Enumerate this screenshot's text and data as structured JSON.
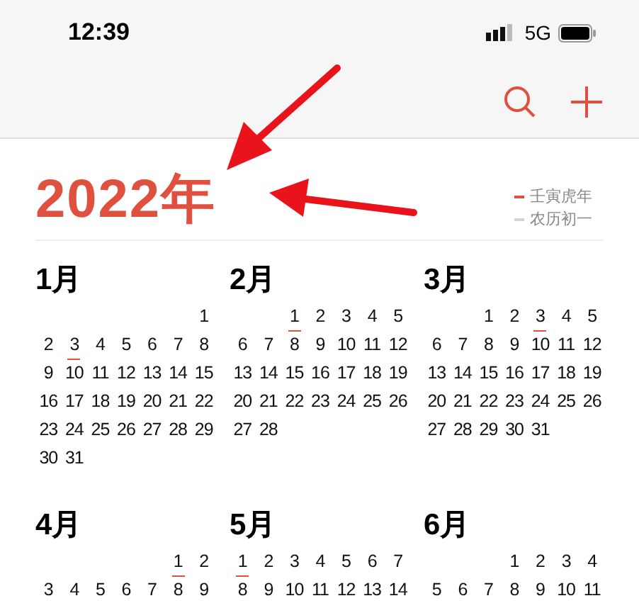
{
  "status_bar": {
    "time": "12:39",
    "network": "5G"
  },
  "year": {
    "title": "2022年",
    "legend": [
      {
        "label": "壬寅虎年",
        "color": "#e0503f"
      },
      {
        "label": "农历初一",
        "color": "#d4d4d4"
      }
    ]
  },
  "months": [
    {
      "title": "1月",
      "weeks": [
        [
          {
            "day": "1",
            "lunar_first": false
          }
        ],
        [
          {
            "day": "2",
            "lunar_first": false
          },
          {
            "day": "3",
            "lunar_first": true
          },
          {
            "day": "4",
            "lunar_first": false
          },
          {
            "day": "5",
            "lunar_first": false
          },
          {
            "day": "6",
            "lunar_first": false
          },
          {
            "day": "7",
            "lunar_first": false
          },
          {
            "day": "8",
            "lunar_first": false
          }
        ],
        [
          {
            "day": "9",
            "lunar_first": false
          },
          {
            "day": "10",
            "lunar_first": false
          },
          {
            "day": "11",
            "lunar_first": false
          },
          {
            "day": "12",
            "lunar_first": false
          },
          {
            "day": "13",
            "lunar_first": false
          },
          {
            "day": "14",
            "lunar_first": false
          },
          {
            "day": "15",
            "lunar_first": false
          }
        ],
        [
          {
            "day": "16",
            "lunar_first": false
          },
          {
            "day": "17",
            "lunar_first": false
          },
          {
            "day": "18",
            "lunar_first": false
          },
          {
            "day": "19",
            "lunar_first": false
          },
          {
            "day": "20",
            "lunar_first": false
          },
          {
            "day": "21",
            "lunar_first": false
          },
          {
            "day": "22",
            "lunar_first": false
          }
        ],
        [
          {
            "day": "23",
            "lunar_first": false
          },
          {
            "day": "24",
            "lunar_first": false
          },
          {
            "day": "25",
            "lunar_first": false
          },
          {
            "day": "26",
            "lunar_first": false
          },
          {
            "day": "27",
            "lunar_first": false
          },
          {
            "day": "28",
            "lunar_first": false
          },
          {
            "day": "29",
            "lunar_first": false
          }
        ],
        [
          {
            "day": "30",
            "lunar_first": false
          },
          {
            "day": "31",
            "lunar_first": false
          }
        ]
      ]
    },
    {
      "title": "2月",
      "weeks": [
        [
          {
            "day": "1",
            "lunar_first": true
          },
          {
            "day": "2",
            "lunar_first": false
          },
          {
            "day": "3",
            "lunar_first": false
          },
          {
            "day": "4",
            "lunar_first": false
          },
          {
            "day": "5",
            "lunar_first": false
          }
        ],
        [
          {
            "day": "6",
            "lunar_first": false
          },
          {
            "day": "7",
            "lunar_first": false
          },
          {
            "day": "8",
            "lunar_first": false
          },
          {
            "day": "9",
            "lunar_first": false
          },
          {
            "day": "10",
            "lunar_first": false
          },
          {
            "day": "11",
            "lunar_first": false
          },
          {
            "day": "12",
            "lunar_first": false
          }
        ],
        [
          {
            "day": "13",
            "lunar_first": false
          },
          {
            "day": "14",
            "lunar_first": false
          },
          {
            "day": "15",
            "lunar_first": false
          },
          {
            "day": "16",
            "lunar_first": false
          },
          {
            "day": "17",
            "lunar_first": false
          },
          {
            "day": "18",
            "lunar_first": false
          },
          {
            "day": "19",
            "lunar_first": false
          }
        ],
        [
          {
            "day": "20",
            "lunar_first": false
          },
          {
            "day": "21",
            "lunar_first": false
          },
          {
            "day": "22",
            "lunar_first": false
          },
          {
            "day": "23",
            "lunar_first": false
          },
          {
            "day": "24",
            "lunar_first": false
          },
          {
            "day": "25",
            "lunar_first": false
          },
          {
            "day": "26",
            "lunar_first": false
          }
        ],
        [
          {
            "day": "27",
            "lunar_first": false
          },
          {
            "day": "28",
            "lunar_first": false
          }
        ]
      ]
    },
    {
      "title": "3月",
      "weeks": [
        [
          {
            "day": "1",
            "lunar_first": false
          },
          {
            "day": "2",
            "lunar_first": false
          },
          {
            "day": "3",
            "lunar_first": true
          },
          {
            "day": "4",
            "lunar_first": false
          },
          {
            "day": "5",
            "lunar_first": false
          }
        ],
        [
          {
            "day": "6",
            "lunar_first": false
          },
          {
            "day": "7",
            "lunar_first": false
          },
          {
            "day": "8",
            "lunar_first": false
          },
          {
            "day": "9",
            "lunar_first": false
          },
          {
            "day": "10",
            "lunar_first": false
          },
          {
            "day": "11",
            "lunar_first": false
          },
          {
            "day": "12",
            "lunar_first": false
          }
        ],
        [
          {
            "day": "13",
            "lunar_first": false
          },
          {
            "day": "14",
            "lunar_first": false
          },
          {
            "day": "15",
            "lunar_first": false
          },
          {
            "day": "16",
            "lunar_first": false
          },
          {
            "day": "17",
            "lunar_first": false
          },
          {
            "day": "18",
            "lunar_first": false
          },
          {
            "day": "19",
            "lunar_first": false
          }
        ],
        [
          {
            "day": "20",
            "lunar_first": false
          },
          {
            "day": "21",
            "lunar_first": false
          },
          {
            "day": "22",
            "lunar_first": false
          },
          {
            "day": "23",
            "lunar_first": false
          },
          {
            "day": "24",
            "lunar_first": false
          },
          {
            "day": "25",
            "lunar_first": false
          },
          {
            "day": "26",
            "lunar_first": false
          }
        ],
        [
          {
            "day": "27",
            "lunar_first": false
          },
          {
            "day": "28",
            "lunar_first": false
          },
          {
            "day": "29",
            "lunar_first": false
          },
          {
            "day": "30",
            "lunar_first": false
          },
          {
            "day": "31",
            "lunar_first": false
          }
        ]
      ]
    },
    {
      "title": "4月",
      "weeks": [
        [
          {
            "day": "1",
            "lunar_first": true
          },
          {
            "day": "2",
            "lunar_first": false
          }
        ],
        [
          {
            "day": "3",
            "lunar_first": false
          },
          {
            "day": "4",
            "lunar_first": false
          },
          {
            "day": "5",
            "lunar_first": false
          },
          {
            "day": "6",
            "lunar_first": false
          },
          {
            "day": "7",
            "lunar_first": false
          },
          {
            "day": "8",
            "lunar_first": false
          },
          {
            "day": "9",
            "lunar_first": false
          }
        ]
      ]
    },
    {
      "title": "5月",
      "weeks": [
        [
          {
            "day": "1",
            "lunar_first": true
          },
          {
            "day": "2",
            "lunar_first": false
          },
          {
            "day": "3",
            "lunar_first": false
          },
          {
            "day": "4",
            "lunar_first": false
          },
          {
            "day": "5",
            "lunar_first": false
          },
          {
            "day": "6",
            "lunar_first": false
          },
          {
            "day": "7",
            "lunar_first": false
          }
        ],
        [
          {
            "day": "8",
            "lunar_first": false
          },
          {
            "day": "9",
            "lunar_first": false
          },
          {
            "day": "10",
            "lunar_first": false
          },
          {
            "day": "11",
            "lunar_first": false
          },
          {
            "day": "12",
            "lunar_first": false
          },
          {
            "day": "13",
            "lunar_first": false
          },
          {
            "day": "14",
            "lunar_first": false
          }
        ]
      ]
    },
    {
      "title": "6月",
      "weeks": [
        [
          {
            "day": "1",
            "lunar_first": false
          },
          {
            "day": "2",
            "lunar_first": false
          },
          {
            "day": "3",
            "lunar_first": false
          },
          {
            "day": "4",
            "lunar_first": false
          }
        ],
        [
          {
            "day": "5",
            "lunar_first": false
          },
          {
            "day": "6",
            "lunar_first": false
          },
          {
            "day": "7",
            "lunar_first": false
          },
          {
            "day": "8",
            "lunar_first": false
          },
          {
            "day": "9",
            "lunar_first": false
          },
          {
            "day": "10",
            "lunar_first": false
          },
          {
            "day": "11",
            "lunar_first": false
          }
        ]
      ]
    }
  ]
}
